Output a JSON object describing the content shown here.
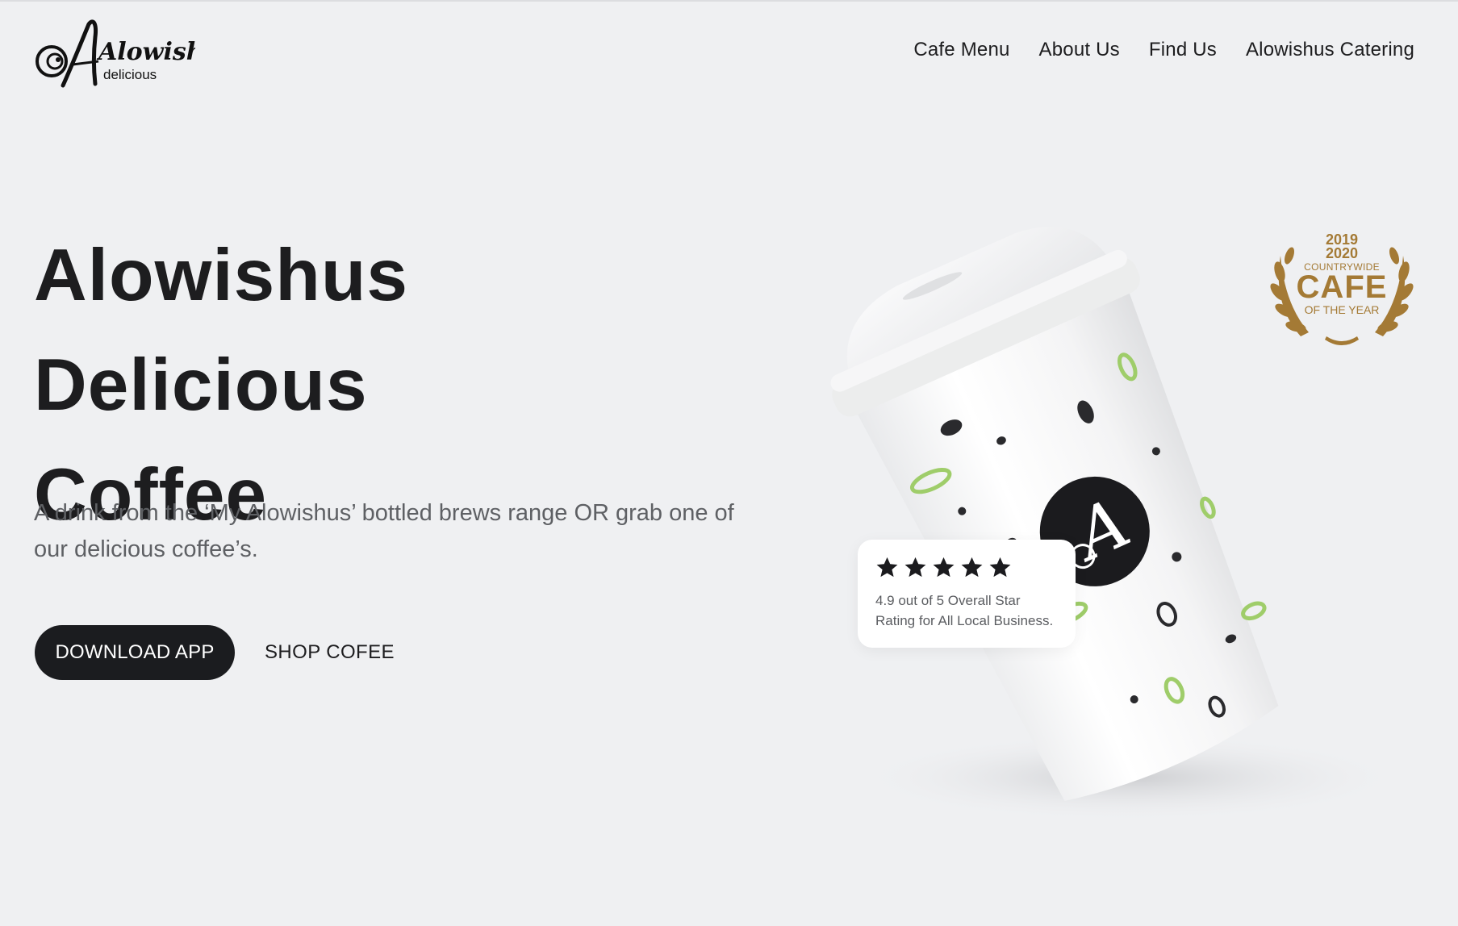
{
  "brand": {
    "logo_script": "Alowishus",
    "logo_subtext": "delicious"
  },
  "nav": {
    "items": [
      {
        "label": "Cafe Menu"
      },
      {
        "label": "About Us"
      },
      {
        "label": "Find Us"
      },
      {
        "label": "Alowishus Catering"
      }
    ]
  },
  "hero": {
    "title_line1": "Alowishus Delicious",
    "title_line2": "Coffee",
    "description": "A drink from the ‘My Alowishus’ bottled brews range OR grab one of our delicious coffee’s.",
    "primary_button": "DOWNLOAD APP",
    "secondary_button": "SHOP COFEE"
  },
  "award": {
    "years_line1": "2019",
    "years_line2": "2020",
    "label_top": "COUNTRYWIDE",
    "label_main": "CAFE",
    "label_bottom": "OF THE YEAR",
    "color": "#a47a35"
  },
  "rating": {
    "stars": 5,
    "line1": "4.9 out of 5 Overall Star",
    "line2": "Rating for All Local Business."
  },
  "cup": {
    "monogram": "A",
    "accent_leaf_color": "#9fcd6a",
    "dark_leaf_color": "#2a2a2d"
  },
  "colors": {
    "background": "#eff0f2",
    "text": "#1d1d1f",
    "button_bg": "#1b1c1f"
  }
}
